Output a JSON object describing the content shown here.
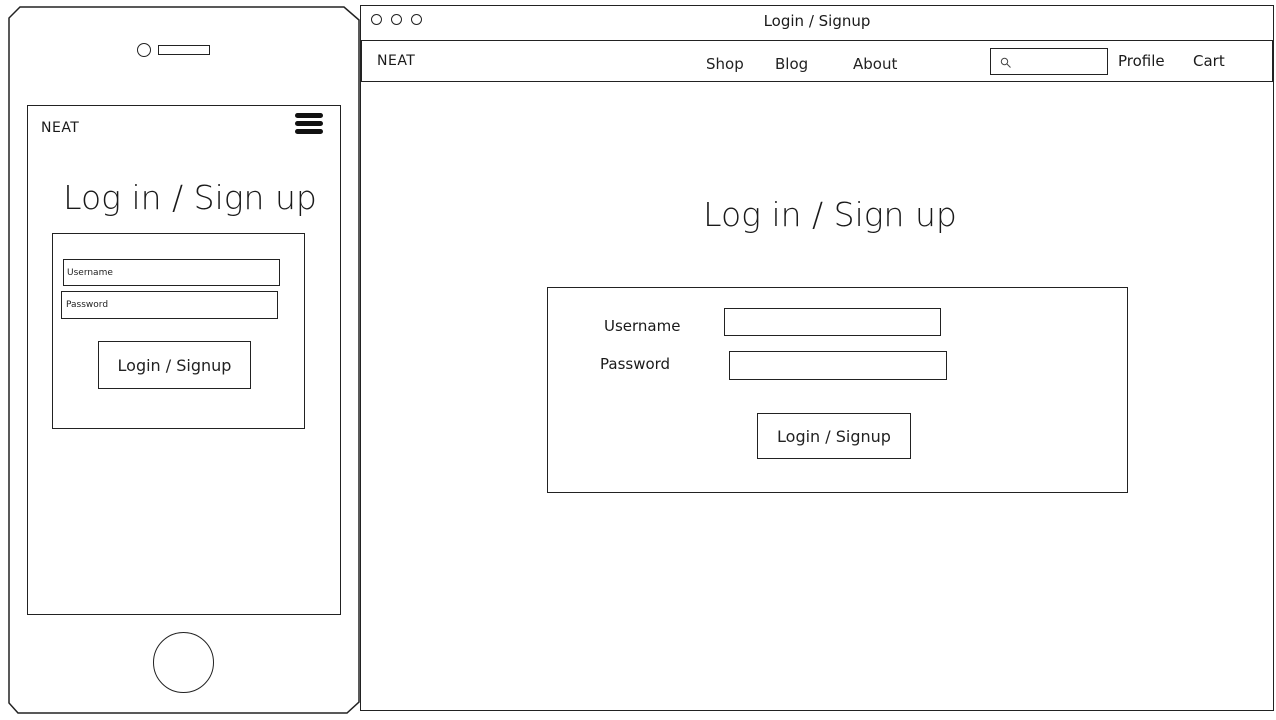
{
  "window": {
    "title": "Login / Signup"
  },
  "mobile": {
    "logo": "NEAT",
    "heading": "Log in / Sign up",
    "username_placeholder": "Username",
    "password_placeholder": "Password",
    "button_label": "Login / Signup"
  },
  "desktop": {
    "logo": "NEAT",
    "nav": {
      "shop": "Shop",
      "blog": "Blog",
      "about": "About",
      "profile": "Profile",
      "cart": "Cart"
    },
    "search_icon": "search-icon",
    "heading": "Log in / Sign up",
    "username_label": "Username",
    "password_label": "Password",
    "button_label": "Login / Signup"
  }
}
